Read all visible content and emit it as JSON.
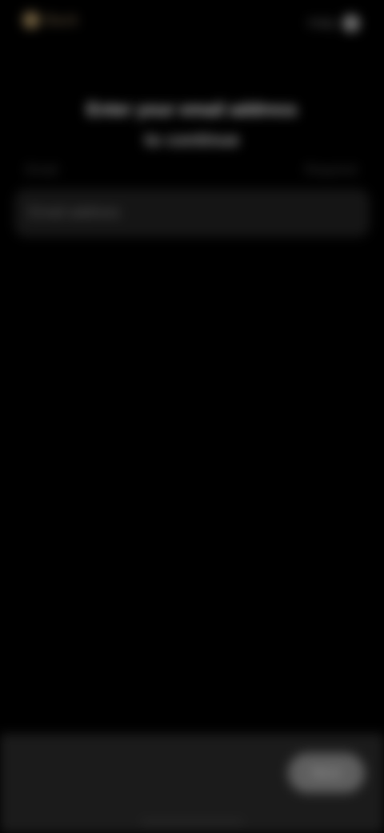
{
  "top_bar": {
    "back_label": "Back",
    "back_icon": "chevron-left-icon",
    "action_label": "Help",
    "action_icon": "info-circle-icon"
  },
  "heading": {
    "title": "Enter your email address",
    "subtitle": "to continue"
  },
  "section": {
    "left_label": "Email",
    "right_label": "Required"
  },
  "field": {
    "value": "",
    "placeholder": "Email address"
  },
  "bottom_bar": {
    "hint": "",
    "primary_label": "Next"
  },
  "colors": {
    "background": "#000000",
    "accent": "#c8a66a",
    "card": "#151515",
    "toolbar": "#1b1b1b",
    "button": "#5e5e5e"
  }
}
